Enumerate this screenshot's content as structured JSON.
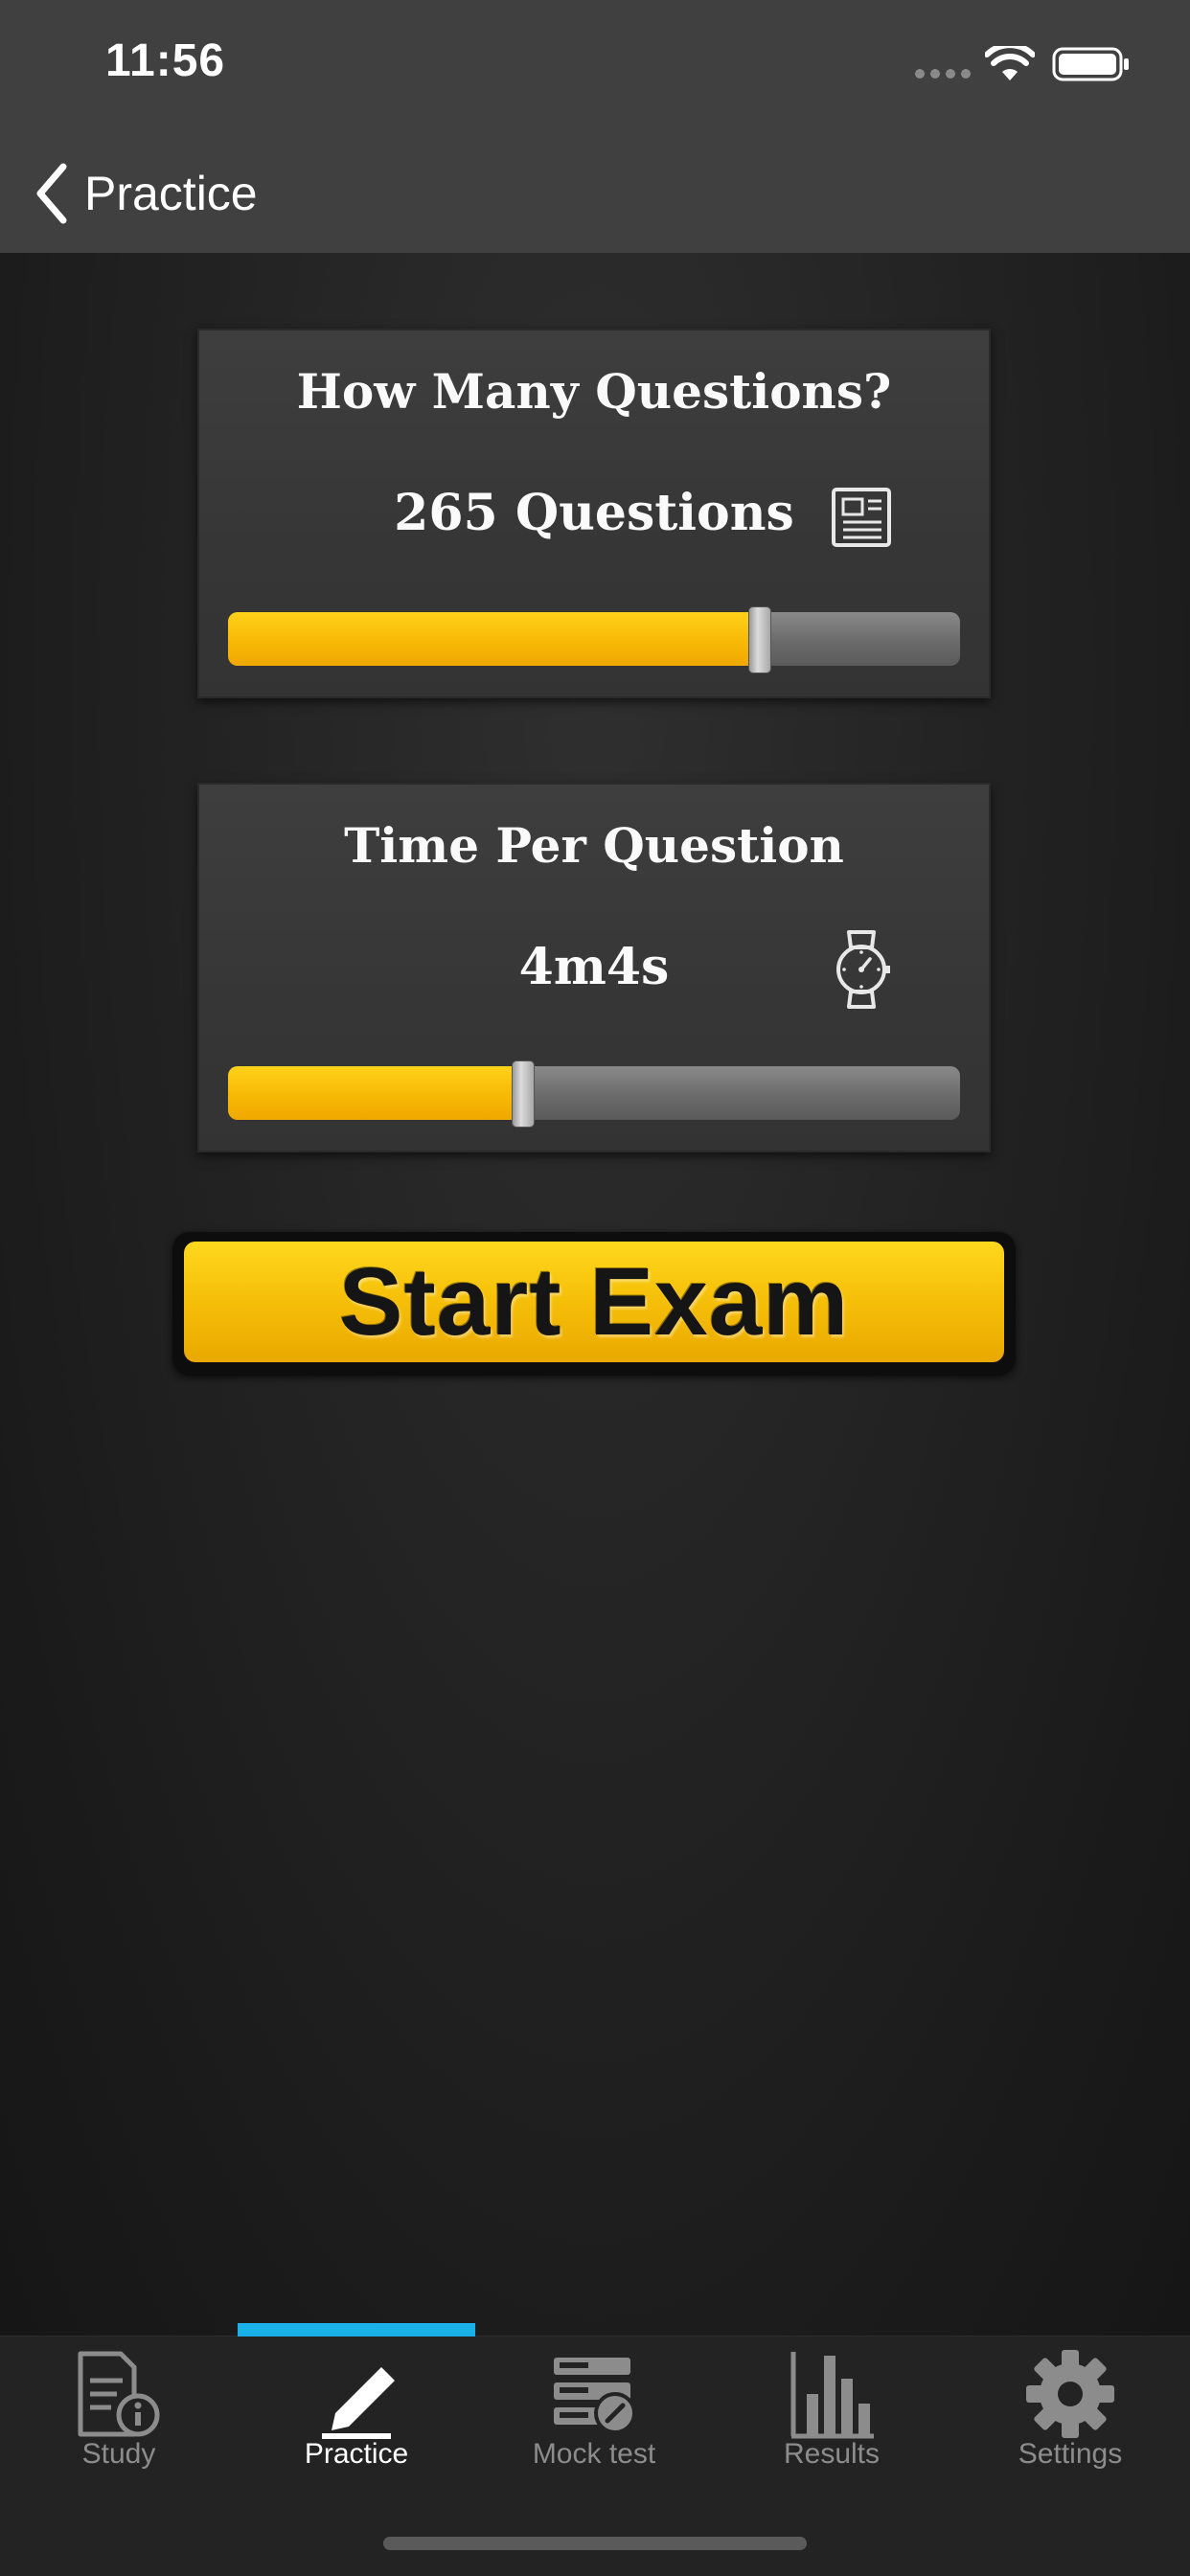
{
  "status_bar": {
    "time": "11:56"
  },
  "nav": {
    "back_label": "Practice"
  },
  "questions_card": {
    "title": "How Many Questions?",
    "value": "265 Questions",
    "icon": "newspaper-icon",
    "slider_fraction": 0.725
  },
  "time_card": {
    "title": "Time Per Question",
    "value": "4m4s",
    "icon": "watch-icon",
    "slider_fraction": 0.402
  },
  "start_button": {
    "label": "Start Exam"
  },
  "tabs": [
    {
      "label": "Study",
      "icon": "study-document-icon",
      "active": false
    },
    {
      "label": "Practice",
      "icon": "pencil-icon",
      "active": true
    },
    {
      "label": "Mock test",
      "icon": "mock-test-icon",
      "active": false
    },
    {
      "label": "Results",
      "icon": "bar-chart-icon",
      "active": false
    },
    {
      "label": "Settings",
      "icon": "gear-icon",
      "active": false
    }
  ],
  "colors": {
    "accent_yellow": "#f8bb06",
    "tab_indicator": "#1ab1e8",
    "bar_bg": "#404040"
  }
}
